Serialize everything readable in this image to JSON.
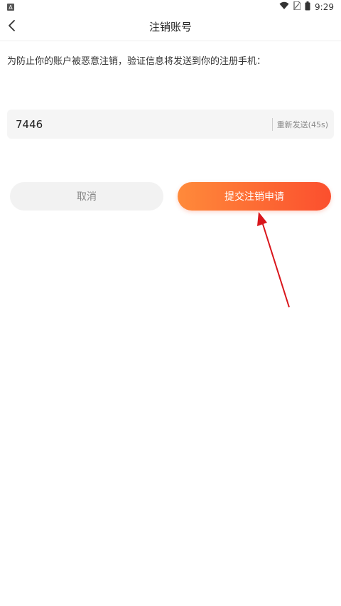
{
  "status_bar": {
    "left_icon": "a-app-icon",
    "time": "9:29",
    "icons": [
      "wifi-icon",
      "sim-icon",
      "battery-icon"
    ]
  },
  "navbar": {
    "title": "注销账号",
    "back_icon": "chevron-left-icon"
  },
  "description": "为防止你的账户被恶意注销，验证信息将发送到你的注册手机：",
  "code_field": {
    "value": "7446",
    "resend_label": "重新发送(45s)"
  },
  "buttons": {
    "cancel_label": "取消",
    "submit_label": "提交注销申请"
  },
  "colors": {
    "accent_start": "#ff8a3a",
    "accent_end": "#fb4f2e",
    "annotation_arrow": "#d9161c"
  }
}
